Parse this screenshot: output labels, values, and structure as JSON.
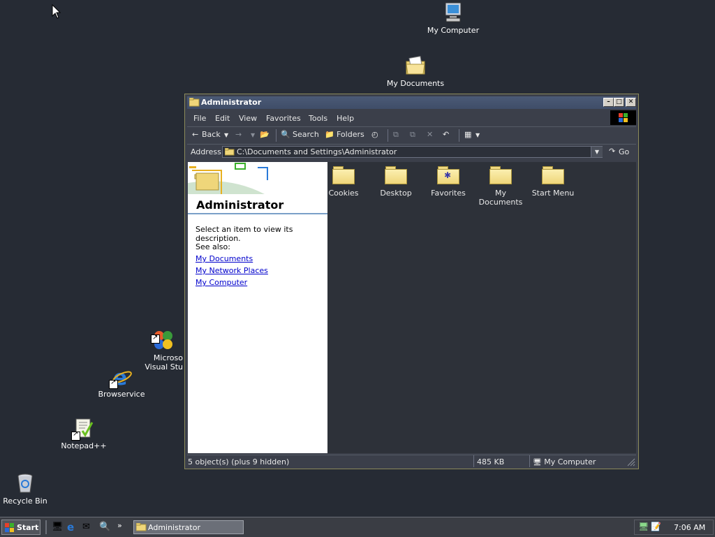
{
  "desktop": {
    "icons": [
      {
        "label": "My Computer"
      },
      {
        "label": "My Documents"
      },
      {
        "label": "Microso\nVisual Stu"
      },
      {
        "label": "Browservice"
      },
      {
        "label": "Notepad++"
      },
      {
        "label": "Recycle Bin"
      }
    ]
  },
  "window": {
    "title": "Administrator",
    "menu": [
      "File",
      "Edit",
      "View",
      "Favorites",
      "Tools",
      "Help"
    ],
    "toolbar": {
      "back": "Back",
      "search": "Search",
      "folders": "Folders"
    },
    "address": {
      "label": "Address",
      "value": "C:\\Documents and Settings\\Administrator",
      "go": "Go"
    },
    "leftpane": {
      "heading": "Administrator",
      "description": "Select an item to view its description.",
      "see_also": "See also:",
      "links": [
        "My Documents",
        "My Network Places",
        "My Computer"
      ]
    },
    "items": [
      {
        "label": "Cookies"
      },
      {
        "label": "Desktop"
      },
      {
        "label": "Favorites"
      },
      {
        "label": "My Documents"
      },
      {
        "label": "Start Menu"
      }
    ],
    "status": {
      "objects": "5 object(s) (plus 9 hidden)",
      "size": "485 KB",
      "zone": "My Computer"
    }
  },
  "taskbar": {
    "start": "Start",
    "task": "Administrator",
    "clock": "7:06 AM"
  },
  "colors": {
    "desktop": "#262b34",
    "link": "#0000cc",
    "folder": "#efd67a"
  }
}
